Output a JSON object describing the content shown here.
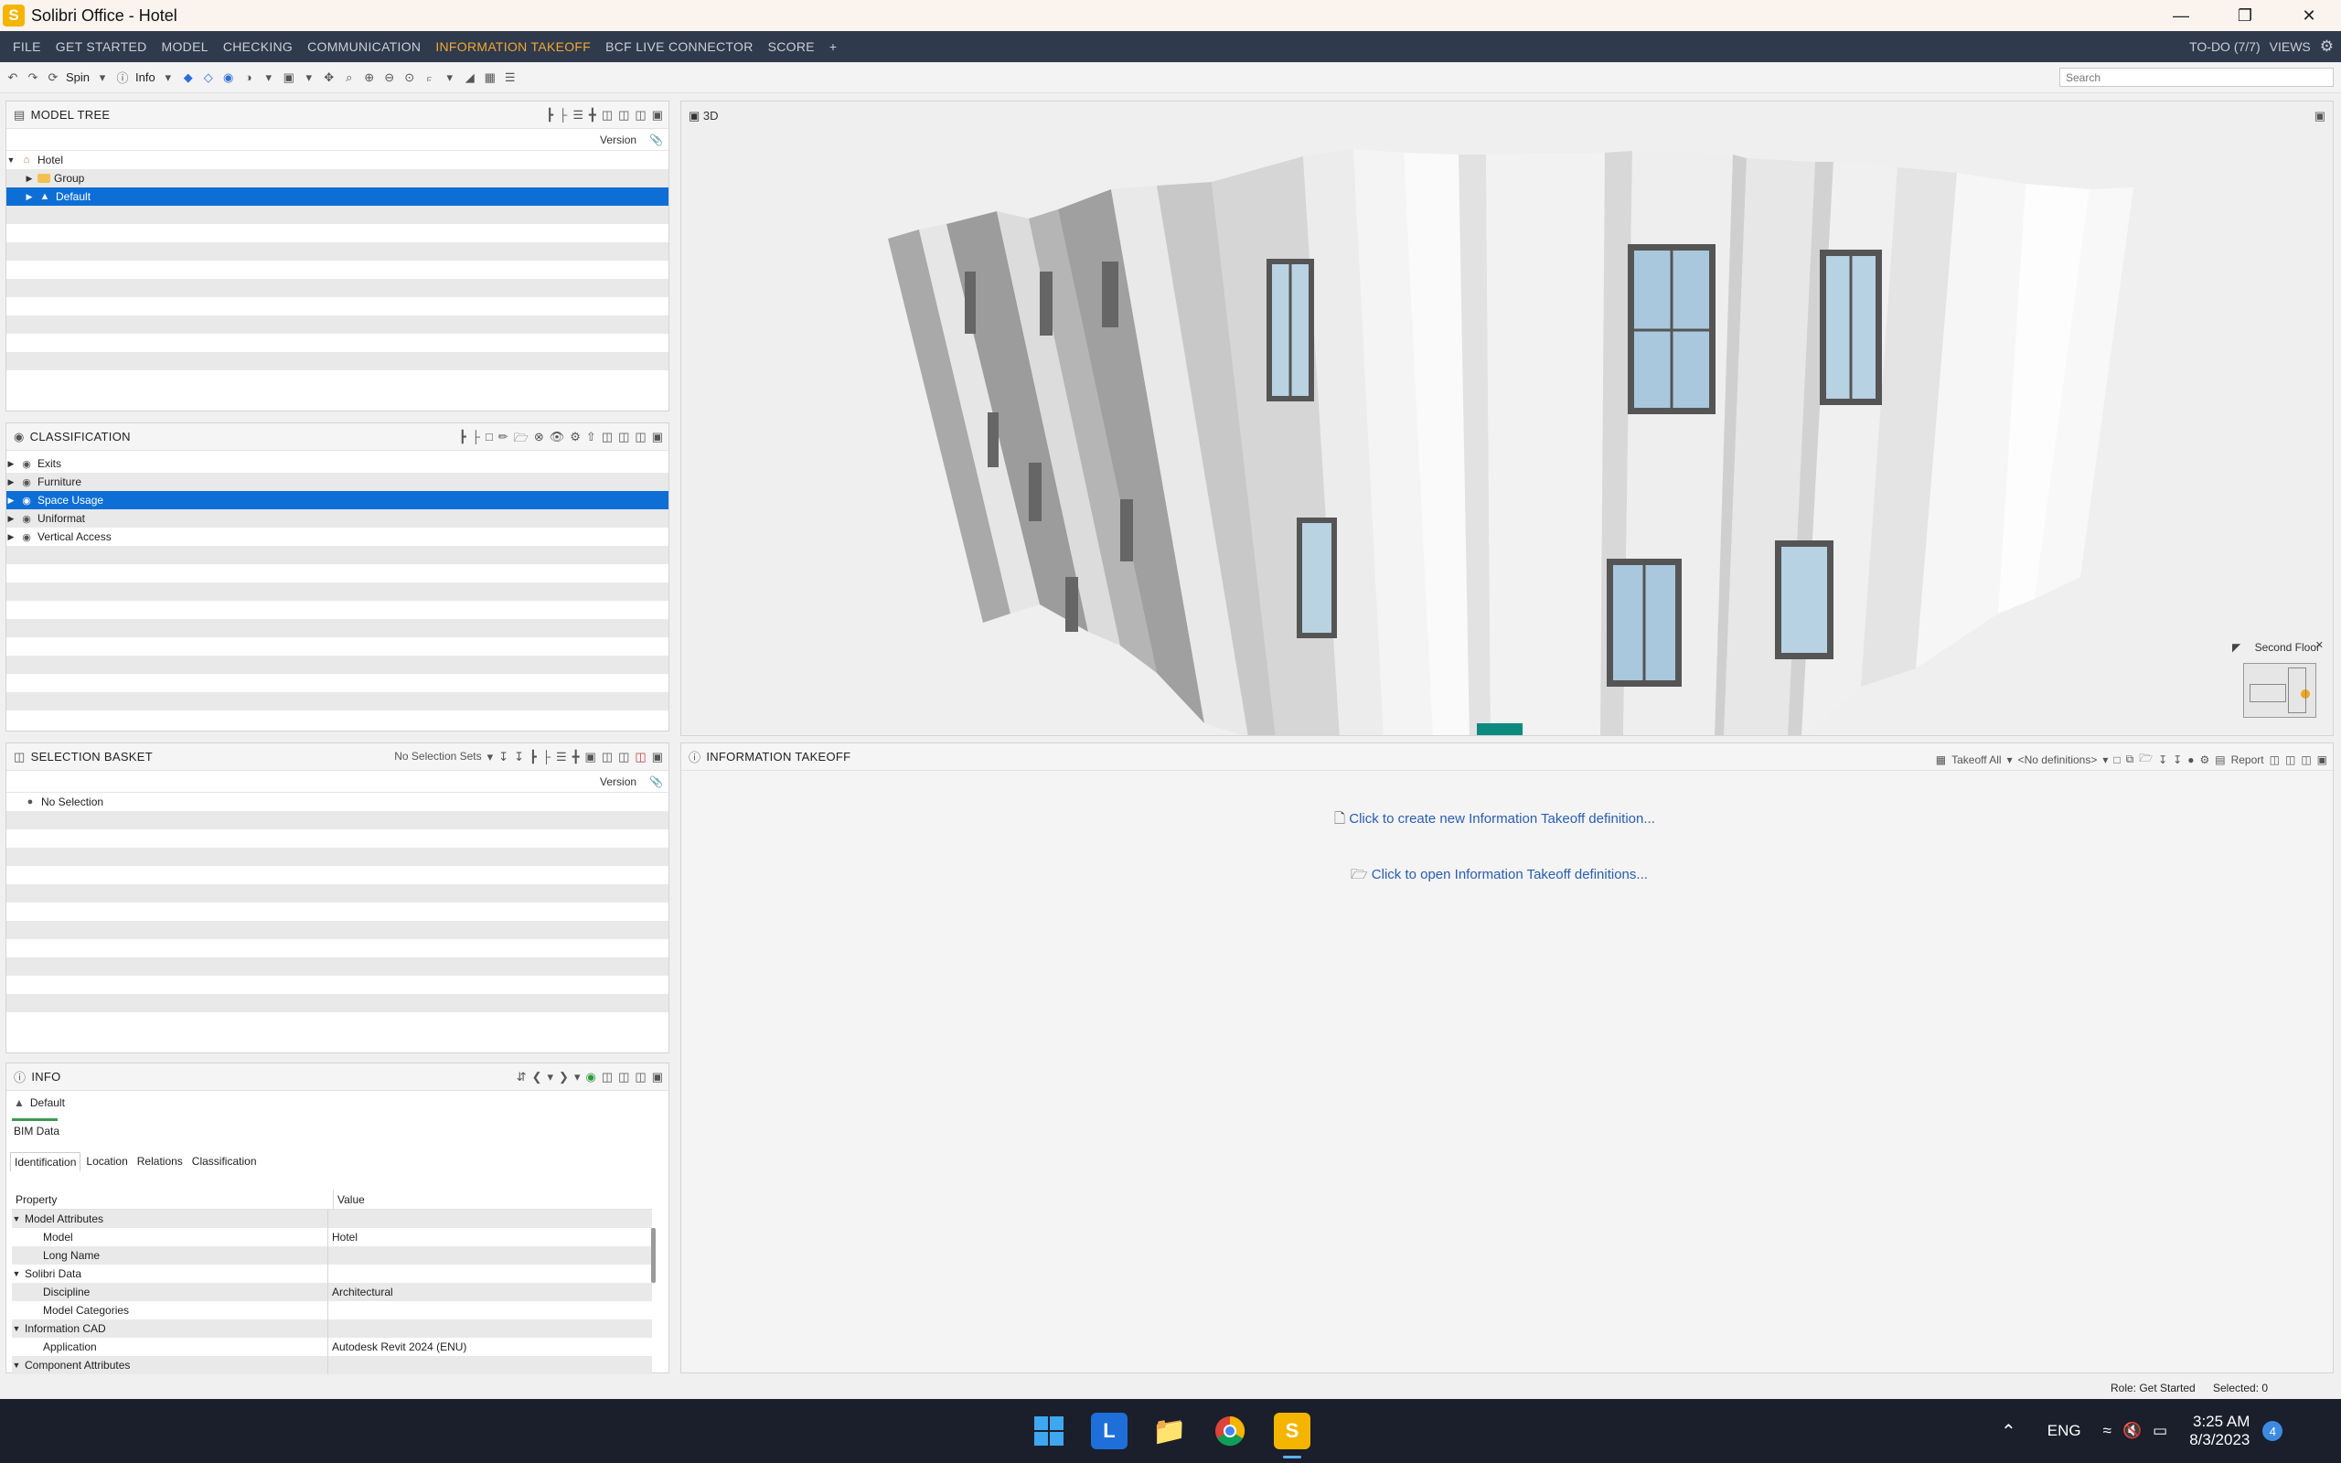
{
  "window": {
    "title": "Solibri Office - Hotel",
    "logo_letter": "S"
  },
  "menu": {
    "items": [
      "FILE",
      "GET STARTED",
      "MODEL",
      "CHECKING",
      "COMMUNICATION",
      "INFORMATION TAKEOFF",
      "BCF LIVE CONNECTOR",
      "SCORE",
      "+"
    ],
    "active": "INFORMATION TAKEOFF",
    "todo": "TO-DO (7/7)",
    "views": "VIEWS"
  },
  "toolbar": {
    "spin_label": "Spin",
    "info_label": "Info",
    "search_placeholder": "Search"
  },
  "model_tree": {
    "title": "MODEL TREE",
    "column": "Version",
    "items": [
      {
        "label": "Hotel",
        "level": 0,
        "expanded": true,
        "icon": "building-icon"
      },
      {
        "label": "Group",
        "level": 1,
        "icon": "folder-icon"
      },
      {
        "label": "Default",
        "level": 1,
        "selected": true,
        "icon": "model-icon"
      }
    ]
  },
  "classification": {
    "title": "CLASSIFICATION",
    "items": [
      "Exits",
      "Furniture",
      "Space Usage",
      "Uniformat",
      "Vertical Access"
    ],
    "selected": "Space Usage"
  },
  "selection_basket": {
    "title": "SELECTION BASKET",
    "sets_label": "No Selection Sets",
    "column": "Version",
    "empty_label": "No Selection"
  },
  "view3d": {
    "title": "3D",
    "floor_label": "Second Floor"
  },
  "takeoff": {
    "title": "INFORMATION TAKEOFF",
    "takeoff_all": "Takeoff All",
    "definitions": "<No definitions>",
    "report": "Report",
    "create_link": "Click to create new Information Takeoff definition...",
    "open_link": "Click to open Information Takeoff definitions..."
  },
  "info": {
    "title": "INFO",
    "object": "Default",
    "bim_tab": "BIM Data",
    "tabs": [
      "Identification",
      "Location",
      "Relations",
      "Classification"
    ],
    "col_property": "Property",
    "col_value": "Value",
    "rows": [
      {
        "k": "Model Attributes",
        "v": "",
        "group": true
      },
      {
        "k": "Model",
        "v": "Hotel"
      },
      {
        "k": "Long Name",
        "v": ""
      },
      {
        "k": "Solibri Data",
        "v": "",
        "group": true
      },
      {
        "k": "Discipline",
        "v": "Architectural"
      },
      {
        "k": "Model Categories",
        "v": ""
      },
      {
        "k": "Information CAD",
        "v": "",
        "group": true
      },
      {
        "k": "Application",
        "v": "Autodesk Revit 2024 (ENU)"
      },
      {
        "k": "Component Attributes",
        "v": "",
        "group": true
      }
    ]
  },
  "status": {
    "role": "Role: Get Started",
    "selected": "Selected: 0"
  },
  "taskbar": {
    "lang": "ENG",
    "time": "3:25 AM",
    "date": "8/3/2023",
    "badge": "4"
  },
  "colors": {
    "menubar": "#2f3a4c",
    "active_menu": "#f0a832",
    "selection": "#0d6fd6",
    "link": "#2a5db0"
  }
}
